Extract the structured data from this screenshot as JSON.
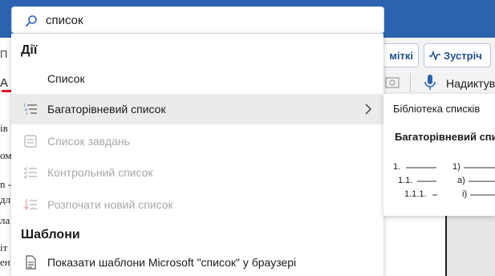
{
  "search": {
    "value": "список"
  },
  "ribbon": {
    "changes_label": "міткі",
    "meeting_label": "Зустріч",
    "dictate_label": "Надиктувати"
  },
  "document_fragments": [
    "П",
    "А",
    "ів",
    "ому",
    "n -",
    "дл",
    "ла",
    "іт",
    "ен"
  ],
  "dropdown": {
    "actions_header": "Дії",
    "items": [
      {
        "label": "Список",
        "icon": "none",
        "disabled": false
      },
      {
        "label": "Багаторівневий список",
        "icon": "multilevel-list-icon",
        "disabled": false,
        "has_submenu": true
      },
      {
        "label": "Список завдань",
        "icon": "task-list-icon",
        "disabled": true
      },
      {
        "label": "Контрольний список",
        "icon": "checklist-icon",
        "disabled": true
      },
      {
        "label": "Розпочати новий список",
        "icon": "new-list-icon",
        "disabled": true
      }
    ],
    "templates_header": "Шаблони",
    "templates_item": {
      "label": "Показати шаблони Microsoft \"список\" у браузері",
      "icon": "document-icon"
    }
  },
  "flyout": {
    "title": "Бібліотека списків",
    "subtitle": "Багаторівневий спи",
    "preview_left": [
      "1.",
      "1.1.",
      "1.1.1."
    ],
    "preview_right": [
      "1)",
      "a)",
      "i)"
    ]
  },
  "colors": {
    "accent": "#2b63b0",
    "hover": "#ebebeb",
    "disabled_text": "#a8a8a8"
  }
}
